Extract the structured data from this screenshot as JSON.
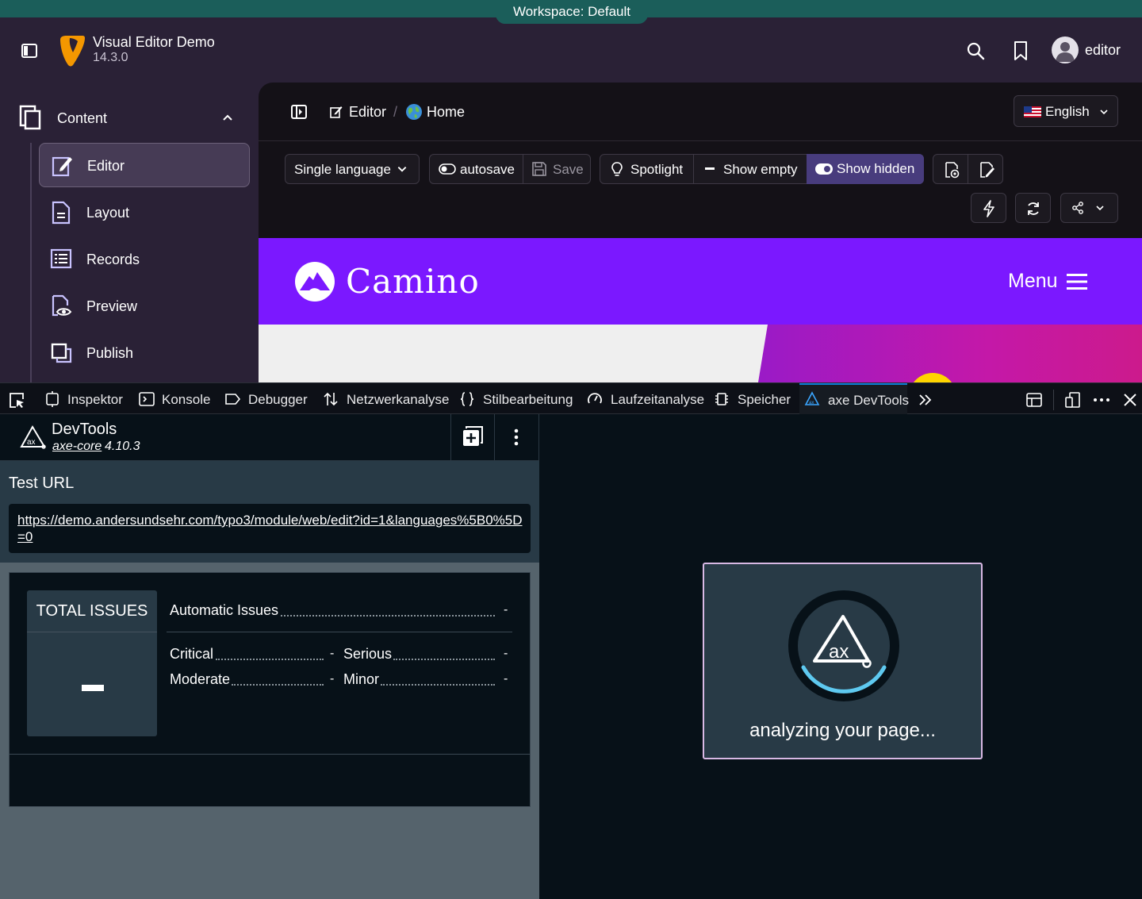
{
  "workspace": {
    "label": "Workspace: Default"
  },
  "app": {
    "title": "Visual Editor Demo",
    "version": "14.3.0"
  },
  "user": {
    "name": "editor"
  },
  "sidebar": {
    "section_label": "Content",
    "items": [
      {
        "label": "Editor",
        "icon": "edit-page-icon",
        "active": true
      },
      {
        "label": "Layout",
        "icon": "layout-page-icon"
      },
      {
        "label": "Records",
        "icon": "records-list-icon"
      },
      {
        "label": "Preview",
        "icon": "preview-eye-icon"
      },
      {
        "label": "Publish",
        "icon": "publish-icon"
      }
    ]
  },
  "breadcrumb": {
    "module": "Editor",
    "separator": "/",
    "page": "Home"
  },
  "language": {
    "selected": "English"
  },
  "toolbar": {
    "language_mode": "Single language",
    "autosave": "autosave",
    "save": "Save",
    "spotlight": "Spotlight",
    "show_empty": "Show empty",
    "show_hidden": "Show hidden"
  },
  "site": {
    "name": "Camino",
    "menu": "Menu"
  },
  "devtools": {
    "tabs": [
      "Inspektor",
      "Konsole",
      "Debugger",
      "Netzwerkanalyse",
      "Stilbearbeitung",
      "Laufzeitanalyse",
      "Speicher",
      "axe DevTools"
    ],
    "active_tab": "axe DevTools"
  },
  "axe": {
    "title": "DevTools",
    "core_link": "axe-core",
    "core_version": "4.10.3",
    "test_url_label": "Test URL",
    "test_url": "https://demo.andersundsehr.com/typo3/module/web/edit?id=1&languages%5B0%5D=0",
    "total_issues_label": "TOTAL ISSUES",
    "automatic_issues_label": "Automatic Issues",
    "automatic_issues_value": "-",
    "critical_label": "Critical",
    "critical_value": "-",
    "serious_label": "Serious",
    "serious_value": "-",
    "moderate_label": "Moderate",
    "moderate_value": "-",
    "minor_label": "Minor",
    "minor_value": "-",
    "loading_text": "analyzing your page..."
  },
  "colors": {
    "typo3_bg": "#2a2136",
    "workspace": "#1b5e5a",
    "site_header": "#7b18ff",
    "active_toggle": "#483c7d",
    "axe_bg": "#071118",
    "axe_panel": "#283a46"
  }
}
